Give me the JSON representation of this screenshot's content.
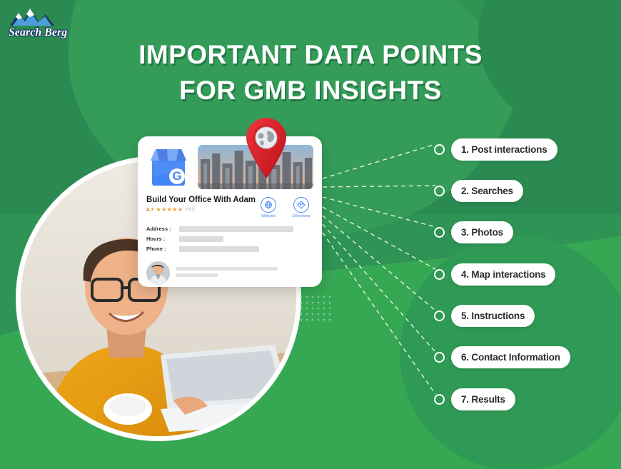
{
  "brand": {
    "logo_text": "Search Berg",
    "logo_icon": "mountain-icon"
  },
  "header": {
    "title_line1": "IMPORTANT DATA POINTS",
    "title_line2": "FOR GMB INSIGHTS"
  },
  "card": {
    "business_icon": "google-my-business-icon",
    "cover_photo": "city-skyline-photo",
    "map_pin_icon": "map-pin-globe-icon",
    "business_name": "Build Your Office With Adam",
    "rating_value": "4.7",
    "stars": "★★★★★",
    "review_count": "(991)",
    "actions": [
      {
        "label": "Website",
        "icon": "globe-icon"
      },
      {
        "label": "Directions",
        "icon": "directions-icon"
      }
    ],
    "fields": [
      {
        "label": "Address :",
        "value_width": 160
      },
      {
        "label": "Hours :",
        "value_width": 62
      },
      {
        "label": "Phone :",
        "value_width": 112
      }
    ],
    "review": {
      "avatar": "user-avatar-photo",
      "line_widths": [
        142,
        58
      ]
    }
  },
  "list": {
    "items": [
      {
        "label": "1. Post interactions"
      },
      {
        "label": "2. Searches"
      },
      {
        "label": "3. Photos"
      },
      {
        "label": "4. Map interactions"
      },
      {
        "label": "5. Instructions"
      },
      {
        "label": "6. Contact Information"
      },
      {
        "label": "7. Results"
      }
    ]
  },
  "colors": {
    "green_dark": "#2b8a51",
    "green_mid": "#2e9354",
    "green_light": "#36a854",
    "white": "#ffffff",
    "pin_red": "#e01f26",
    "google_blue": "#4285f4",
    "star_orange": "#f09a21"
  }
}
